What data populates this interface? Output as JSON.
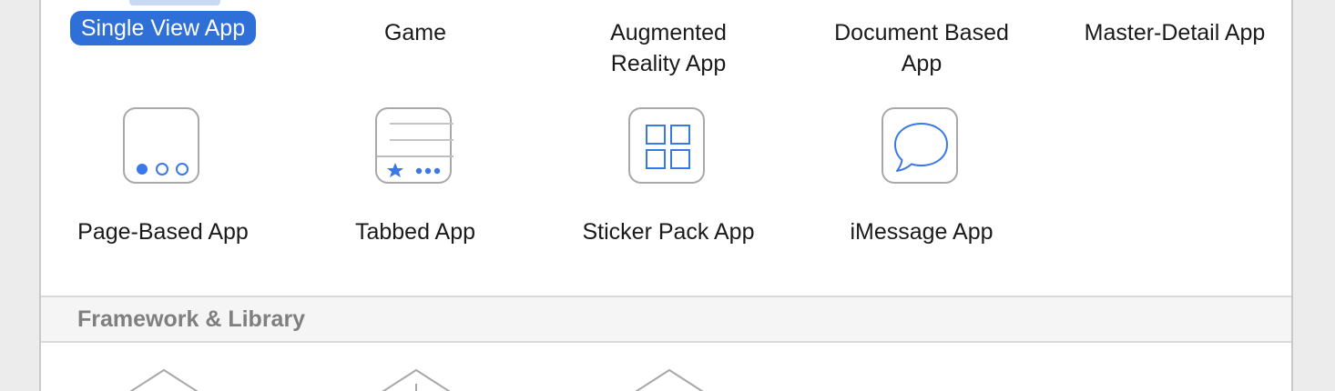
{
  "templates": {
    "row1": [
      {
        "label": "Single View App",
        "selected": true
      },
      {
        "label": "Game"
      },
      {
        "label": "Augmented Reality App"
      },
      {
        "label": "Document Based App"
      },
      {
        "label": "Master-Detail App"
      }
    ],
    "row2": [
      {
        "label": "Page-Based App",
        "icon": "page-dots-icon"
      },
      {
        "label": "Tabbed App",
        "icon": "tab-bar-icon"
      },
      {
        "label": "Sticker Pack App",
        "icon": "sticker-grid-icon"
      },
      {
        "label": "iMessage App",
        "icon": "speech-bubble-icon"
      }
    ]
  },
  "sections": {
    "framework_library": "Framework & Library"
  },
  "colors": {
    "accent": "#2f6fd8",
    "icon_blue": "#3b78e7",
    "icon_border": "#a8a8a8"
  }
}
